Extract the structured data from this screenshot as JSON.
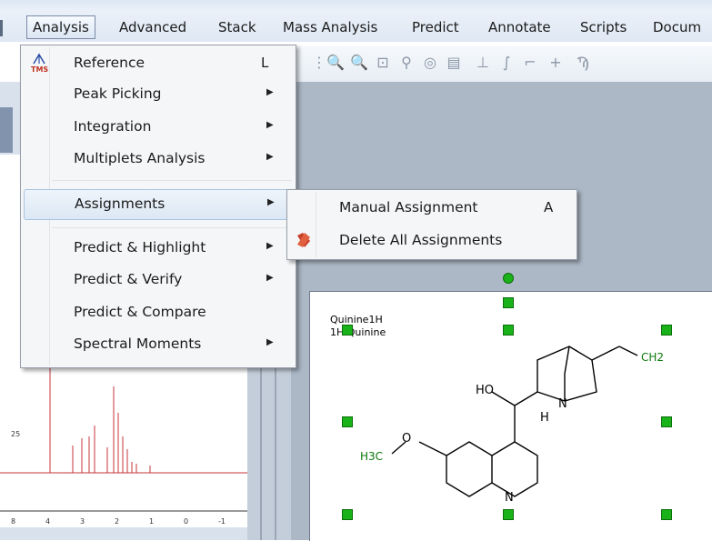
{
  "menubar": {
    "items": [
      {
        "label": "Analysis",
        "active": true
      },
      {
        "label": "Advanced"
      },
      {
        "label": "Stack"
      },
      {
        "label": "Mass Analysis"
      },
      {
        "label": "Predict"
      },
      {
        "label": "Annotate"
      },
      {
        "label": "Scripts"
      },
      {
        "label": "Docum"
      }
    ]
  },
  "analysis_menu": {
    "reference_badge": "TMS",
    "items": [
      {
        "label": "Reference",
        "shortcut": "L",
        "submenu": false
      },
      {
        "label": "Peak Picking",
        "submenu": true
      },
      {
        "label": "Integration",
        "submenu": true
      },
      {
        "label": "Multiplets Analysis",
        "submenu": true
      },
      {
        "label": "Assignments",
        "submenu": true,
        "highlighted": true
      },
      {
        "label": "Predict & Highlight",
        "submenu": true
      },
      {
        "label": "Predict & Verify",
        "submenu": true
      },
      {
        "label": "Predict & Compare",
        "submenu": false
      },
      {
        "label": "Spectral Moments",
        "submenu": true
      }
    ]
  },
  "assignments_submenu": {
    "items": [
      {
        "label": "Manual Assignment",
        "shortcut": "A",
        "icon": "none"
      },
      {
        "label": "Delete All Assignments",
        "icon": "delete-assignments-icon"
      }
    ]
  },
  "spectrum": {
    "peak_label": "25",
    "x_ticks": [
      "8",
      "4",
      "3",
      "2",
      "1",
      "0",
      "-1"
    ]
  },
  "molecule": {
    "title_line1": "Quinine1H",
    "title_line2": "1H Quinine",
    "atom_labels": [
      "HO",
      "H",
      "N",
      "N",
      "H3C",
      "O",
      "CH2"
    ]
  },
  "colors": {
    "menu_highlight": "#dce8f5",
    "handle_green": "#19b319",
    "workspace": "#acb8c6"
  }
}
